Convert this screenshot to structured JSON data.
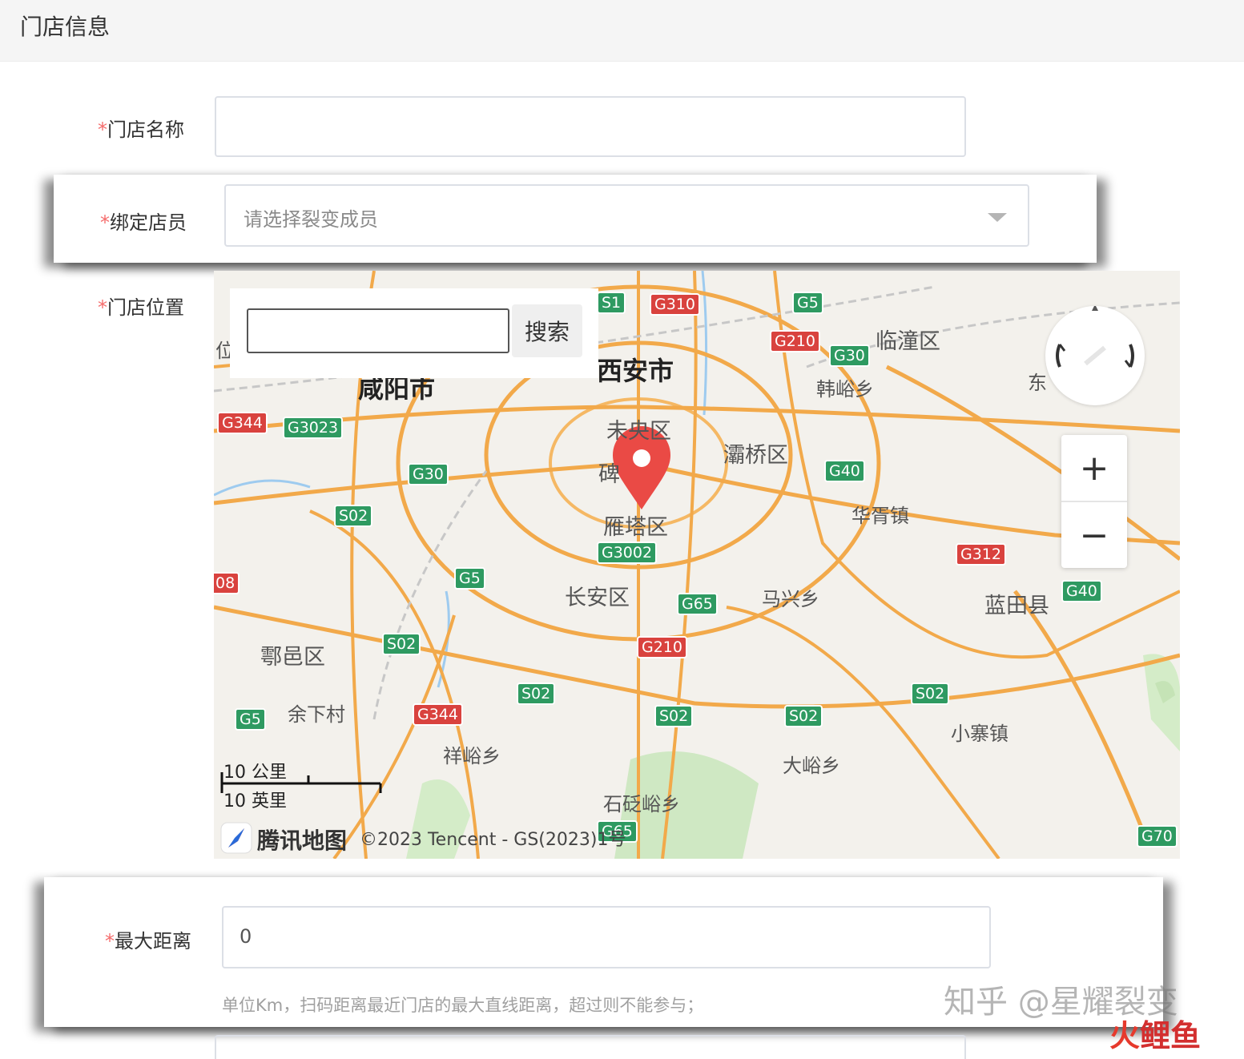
{
  "header": {
    "title": "门店信息"
  },
  "form": {
    "required_mark": "*",
    "store_name": {
      "label": "门店名称",
      "value": ""
    },
    "bind_staff": {
      "label": "绑定店员",
      "placeholder": "请选择裂变成员"
    },
    "location": {
      "label": "门店位置"
    },
    "max_distance": {
      "label": "最大距离",
      "value": "0",
      "hint": "单位Km，扫码距离最近门店的最大直线距离，超过则不能参与；"
    }
  },
  "map": {
    "search_button": "搜索",
    "search_value": "",
    "zoom_in": "+",
    "zoom_out": "−",
    "scale_metric": "10 公里",
    "scale_imperial": "10 英里",
    "brand": "腾讯地图",
    "copyright": "©2023 Tencent - GS(2023)1号",
    "places": {
      "xian": "西安市",
      "xianyang": "咸阳市",
      "weiyang": "未央区",
      "beilin": "碑",
      "baqiao": "灞桥区",
      "lintong": "临潼区",
      "hanyu": "韩峪乡",
      "yanta": "雁塔区",
      "changan": "长安区",
      "huxian": "鄠邑区",
      "yuxia": "余下村",
      "xiangyu": "祥峪乡",
      "maxing": "马兴乡",
      "huaxu": "华胥镇",
      "lantian": "蓝田县",
      "xiaozhai": "小寨镇",
      "dayu": "大峪乡",
      "shiyu": "石砭峪乡",
      "dong": "东",
      "wei": "位"
    },
    "shields": {
      "s1": "S1",
      "g310": "G310",
      "g5a": "G5",
      "g210a": "G210",
      "g30a": "G30",
      "g344a": "G344",
      "g3023": "G3023",
      "g30b": "G30",
      "s02a": "S02",
      "g40a": "G40",
      "g3002": "G3002",
      "g5b": "G5",
      "g65a": "G65",
      "g312": "G312",
      "g40b": "G40",
      "g308": "08",
      "s02b": "S02",
      "g210b": "G210",
      "s02c": "S02",
      "s02d": "S02",
      "s02e": "S02",
      "s02f": "S02",
      "g344b": "G344",
      "g5c": "G5",
      "g65b": "G65",
      "g70": "G70"
    }
  },
  "watermark": {
    "text": "知乎 @星耀裂变",
    "logo_a": "火",
    "logo_b": "鲤鱼"
  },
  "colors": {
    "required": "#f56c6c",
    "highway_green": "#2e9a61",
    "highway_red": "#d9423e",
    "marker": "#ea4a45"
  }
}
